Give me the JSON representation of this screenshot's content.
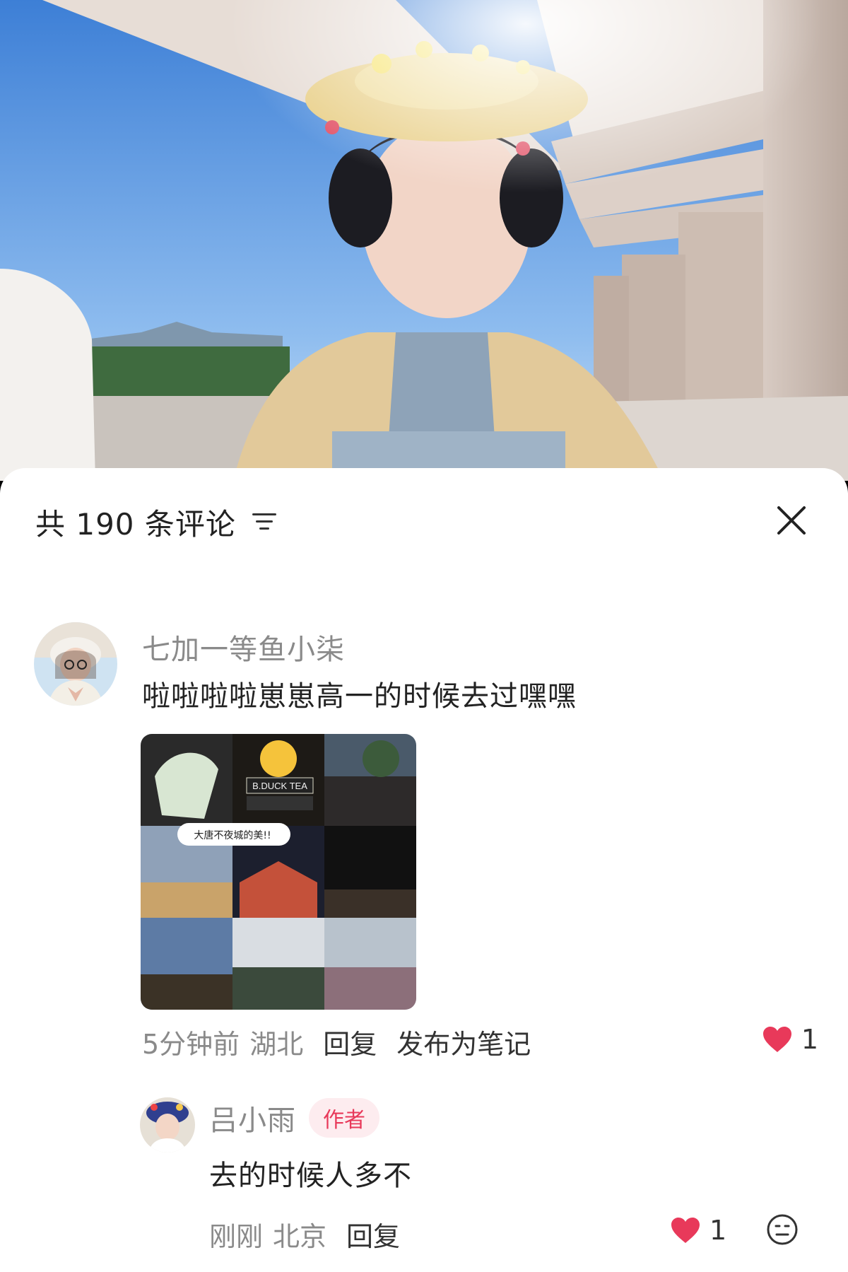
{
  "colors": {
    "like_red": "#e8395a",
    "sheet_bg": "#ffffff",
    "muted_text": "#8a8a8a",
    "body_text": "#222222",
    "author_badge_bg": "#fdecef"
  },
  "sheet": {
    "title": "共 190 条评论",
    "filter_icon": "filter-lines-icon",
    "close_icon": "close-icon"
  },
  "comment": {
    "username": "七加一等鱼小柒",
    "text": "啦啦啦啦崽崽高一的时候去过嘿嘿",
    "collage_sticker_text": "B.DUCK TEA",
    "collage_caption": "大唐不夜城的美!!",
    "time": "5分钟前",
    "location": "湖北",
    "reply_label": "回复",
    "publish_label": "发布为笔记",
    "like_count": "1",
    "liked": true
  },
  "reply": {
    "username": "吕小雨",
    "badge": "作者",
    "text": "去的时候人多不",
    "time": "刚刚",
    "location": "北京",
    "reply_label": "回复",
    "like_count": "1",
    "liked": true,
    "emoji_icon": "emoji-face-icon"
  }
}
